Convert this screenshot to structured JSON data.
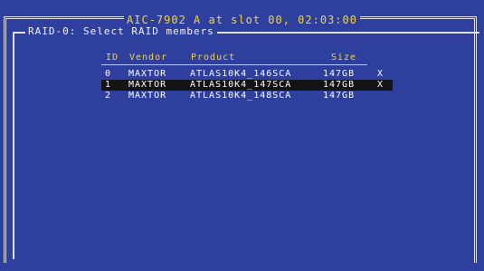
{
  "title": "AIC-7902 A at slot 00, 02:03:00",
  "dialog": {
    "title": "RAID-0: Select RAID members"
  },
  "table": {
    "headers": {
      "id": "ID",
      "vendor": "Vendor",
      "product": "Product",
      "size": "Size"
    },
    "rows": [
      {
        "id": "0",
        "vendor": "MAXTOR",
        "product": "ATLAS10K4_146SCA",
        "size": "147GB",
        "mark": "X",
        "selected": false
      },
      {
        "id": "1",
        "vendor": "MAXTOR",
        "product": "ATLAS10K4_147SCA",
        "size": "147GB",
        "mark": "X",
        "selected": true
      },
      {
        "id": "2",
        "vendor": "MAXTOR",
        "product": "ATLAS10K4_148SCA",
        "size": "147GB",
        "mark": "",
        "selected": false
      }
    ]
  },
  "colors": {
    "background": "#2e3f9e",
    "title_text": "#f3d43c",
    "frame": "#dde1f2",
    "text": "#ffffff",
    "selection": "#141414"
  }
}
